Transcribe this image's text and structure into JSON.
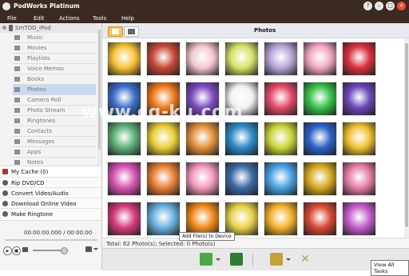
{
  "window": {
    "title": "PodWorks Platinum",
    "controls": [
      "?",
      "–",
      "□",
      "×"
    ]
  },
  "menu": [
    "File",
    "Edit",
    "Actions",
    "Tools",
    "Help"
  ],
  "sidebar": {
    "device": "SmTOO_iPod",
    "items": [
      {
        "label": "Music",
        "selected": false
      },
      {
        "label": "Movies",
        "selected": false
      },
      {
        "label": "Playlists",
        "selected": false
      },
      {
        "label": "Voice Memos",
        "selected": false
      },
      {
        "label": "Books",
        "selected": false
      },
      {
        "label": "Photos",
        "selected": true
      },
      {
        "label": "Camera Roll",
        "selected": false
      },
      {
        "label": "Photo Stream",
        "selected": false
      },
      {
        "label": "Ringtones",
        "selected": false
      },
      {
        "label": "Contacts",
        "selected": false
      },
      {
        "label": "Messages",
        "selected": false
      },
      {
        "label": "Apps",
        "selected": false
      },
      {
        "label": "Notes",
        "selected": false
      }
    ],
    "cache": "My Cache (0)",
    "actions": [
      "Rip DVD/CD",
      "Convert Video/Audio",
      "Download Online Video",
      "Make Ringtone"
    ]
  },
  "player": {
    "time": "00:00:00.000 / 00:00:00"
  },
  "main": {
    "title": "Photos",
    "status": "Total: 62 Photo(s); Selected: 0 Photo(s)",
    "tooltip": "Add File(s) to Device",
    "view_all": "View All Tasks",
    "watermark": "www.cg-ku.com"
  },
  "colors": {
    "titlebar": "#3a2a22",
    "selected_tab": "#f2c45a",
    "selected_item": "#c6daf2"
  },
  "photos": [
    {
      "color": "#f7c33a"
    },
    {
      "color": "#c84a3a"
    },
    {
      "color": "#f3c7cf"
    },
    {
      "color": "#d6e36a"
    },
    {
      "color": "#b9a5d9"
    },
    {
      "color": "#f3a7c2"
    },
    {
      "color": "#d9313d"
    },
    {
      "color": "#3b6fc7"
    },
    {
      "color": "#f07a1d"
    },
    {
      "color": "#7d4cc1"
    },
    {
      "color": "#f4f0f2"
    },
    {
      "color": "#e34a6a"
    },
    {
      "color": "#37c24a"
    },
    {
      "color": "#6b48b8"
    },
    {
      "color": "#5fb07a"
    },
    {
      "color": "#e9cf3a"
    },
    {
      "color": "#e1913d"
    },
    {
      "color": "#2f8ac7"
    },
    {
      "color": "#c9d63a"
    },
    {
      "color": "#2c62c9"
    },
    {
      "color": "#f0c230"
    },
    {
      "color": "#d856b5"
    },
    {
      "color": "#e87f38"
    },
    {
      "color": "#f29ac0"
    },
    {
      "color": "#3d6aa3"
    },
    {
      "color": "#4aa2e3"
    },
    {
      "color": "#d6a91f"
    },
    {
      "color": "#e77fa7"
    },
    {
      "color": "#d23d7b"
    },
    {
      "color": "#6ab1de"
    },
    {
      "color": "#f08a1d"
    },
    {
      "color": "#e7d24b"
    },
    {
      "color": "#f3b22b"
    },
    {
      "color": "#d94836"
    },
    {
      "color": "#c45dcd"
    }
  ]
}
